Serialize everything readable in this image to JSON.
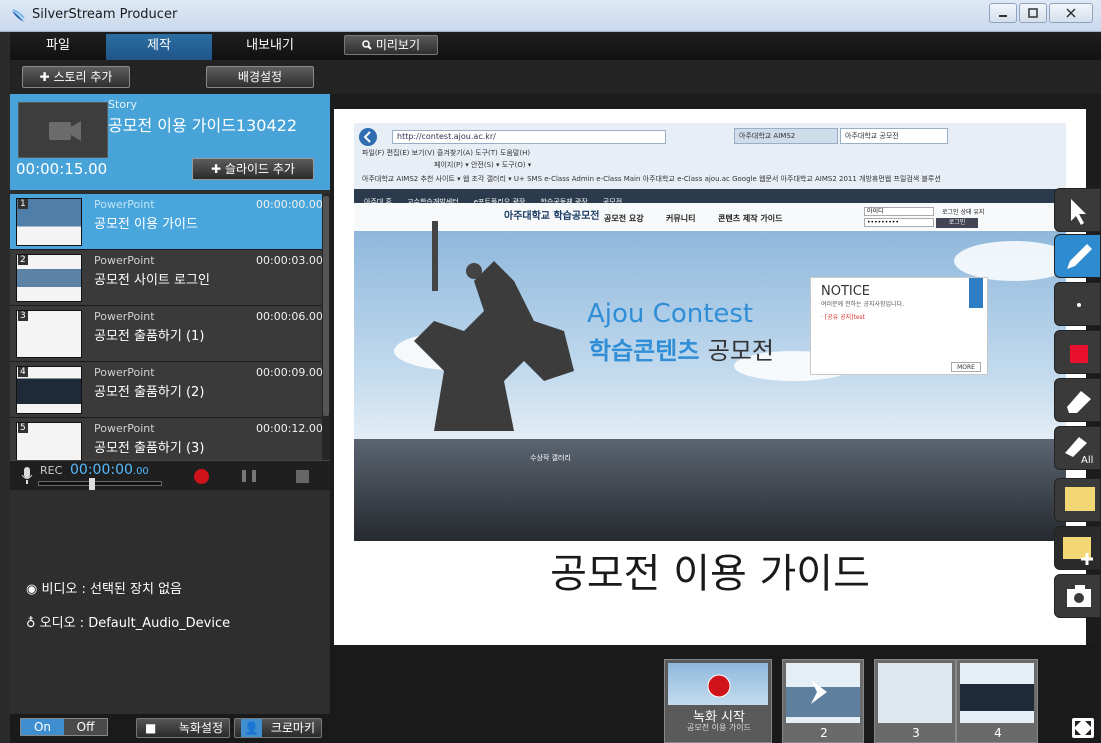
{
  "window": {
    "title": "SilverStream Producer"
  },
  "menu": {
    "tabs": [
      "파일",
      "제작",
      "내보내기"
    ],
    "preview_label": "미리보기"
  },
  "toolbar": {
    "add_story_label": "스토리 추가",
    "background_settings_label": "배경설정"
  },
  "story": {
    "kind": "Story",
    "title": "공모전 이용 가이드130422",
    "duration": "00:00:15.00",
    "add_slide_label": "슬라이드 추가"
  },
  "slides": [
    {
      "num": "1",
      "kind": "PowerPoint",
      "name": "공모전 이용 가이드",
      "time": "00:00:00.00"
    },
    {
      "num": "2",
      "kind": "PowerPoint",
      "name": "공모전 사이트 로그인",
      "time": "00:00:03.00"
    },
    {
      "num": "3",
      "kind": "PowerPoint",
      "name": "공모전 출품하기 (1)",
      "time": "00:00:06.00"
    },
    {
      "num": "4",
      "kind": "PowerPoint",
      "name": "공모전 출품하기 (2)",
      "time": "00:00:09.00"
    },
    {
      "num": "5",
      "kind": "PowerPoint",
      "name": "공모전 출품하기 (3)",
      "time": "00:00:12.00"
    }
  ],
  "recorder": {
    "label": "REC",
    "time": "00:00:00",
    "time_fraction": ".00"
  },
  "devices": {
    "video": "비디오 : 선택된 장치 없음",
    "audio": "오디오 : Default_Audio_Device"
  },
  "bottom": {
    "on_label": "On",
    "off_label": "Off",
    "record_settings_label": "녹화설정",
    "chroma_label": "크로마키"
  },
  "canvas": {
    "caption": "공모전 이용 가이드",
    "browser": {
      "url": "http://contest.ajou.ac.kr/",
      "tab1": "아주대학교 AIMS2",
      "tab2": "아주대학교 공모전",
      "menu_row": "파일(F)  편집(E)  보기(V)  즐겨찾기(A)  도구(T)  도움말(H)",
      "cmd_row": "페이지(P) ▾  안전(S) ▾  도구(O) ▾",
      "fav_row": "아주대학교 AIMS2   추천 사이트 ▾   웹 조각 갤러리 ▾   U+ SMS   e-Class Admin   e-Class Main   아주대학교 e-Class   ajou.ac   Google 웹문서   아주대학교 AIMS2   2011 개방휴먼웹   프릴검색 블루션"
    },
    "site": {
      "nav": [
        "아주대 홈",
        "교수학습개발센터",
        "e포트폴리오 광장",
        "학습공동체 광장",
        "공모전"
      ],
      "logo": "아주대학교 학습공모전",
      "menu": [
        "공모전 요강",
        "커뮤니티",
        "콘텐츠 제작 가이드"
      ],
      "login_id": "아이디",
      "login_pw": "•••••••••",
      "login_btn": "로그인",
      "save_id": "로그인 상태 유지",
      "headline_en": "Ajou Contest",
      "headline_ko_blue": "학습콘텐츠",
      "headline_ko_dark": "공모전",
      "notice_title": "NOTICE",
      "notice_sub": "여러분께 전하는 공지사항입니다.",
      "notice_item": "· [공유 공지]test",
      "notice_more": "MORE",
      "gallery": "수상작 갤러리"
    }
  },
  "filmstrip": {
    "record_start_label": "녹화 시작",
    "record_start_sub": "공모전 이용 가이드",
    "frames": [
      "2",
      "3",
      "4"
    ]
  },
  "colors": {
    "accent": "#48a4d8",
    "record": "#d0131a",
    "headline": "#2f8ed6"
  },
  "icons": [
    "app-icon",
    "plus-icon",
    "search-icon",
    "camera-icon",
    "mic-icon",
    "webcam-icon",
    "pointer-icon",
    "pen-icon",
    "dot-icon",
    "red-square-icon",
    "eraser-icon",
    "eraser-all-icon",
    "sticky-note-icon",
    "sticky-note-add-icon",
    "screenshot-icon",
    "expand-icon"
  ]
}
